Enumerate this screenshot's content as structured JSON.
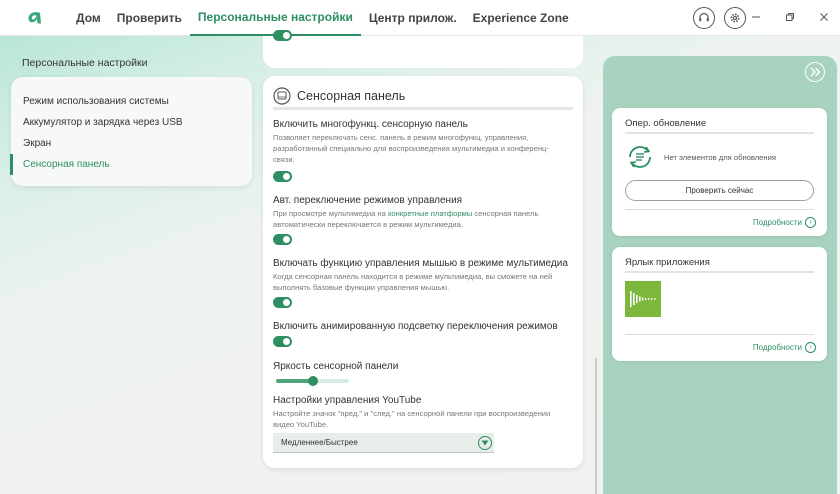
{
  "nav": {
    "items": [
      {
        "label": "Дом"
      },
      {
        "label": "Проверить"
      },
      {
        "label": "Персональные настройки"
      },
      {
        "label": "Центр прилож."
      },
      {
        "label": "Experience Zone"
      }
    ],
    "active_index": 2
  },
  "left": {
    "title": "Персональные настройки",
    "items": [
      {
        "label": "Режим использования системы"
      },
      {
        "label": "Аккумулятор и зарядка через USB"
      },
      {
        "label": "Экран"
      },
      {
        "label": "Сенсорная панель"
      }
    ],
    "active_index": 3
  },
  "touchpad": {
    "title": "Сенсорная панель",
    "multifunction": {
      "title": "Включить многофункц. сенсорную панель",
      "desc": "Позволяет переключать сенс. панель в режим многофункц. управления, разработанный специально для воспроизведения мультимедиа и конференц-связи.",
      "enabled": true
    },
    "auto_switch": {
      "title": "Авт. переключение режимов управления",
      "desc_before": "При просмотре мультимедиа на ",
      "desc_link": "конкретные платформы",
      "desc_after": " сенсорная панель автоматически переключается в режим мультимедиа.",
      "enabled": true
    },
    "mouse_control": {
      "title": "Включать функцию управления мышью в режиме мультимедиа",
      "desc": "Когда сенсорная панель находится в режиме мультимедиа, вы сможете на ней выполнять базовые функции управления мышью.",
      "enabled": true
    },
    "animated_backlight": {
      "title": "Включить анимированную подсветку переключения режимов",
      "enabled": true
    },
    "brightness": {
      "title": "Яркость сенсорной панели",
      "level": 0.5
    },
    "youtube": {
      "title": "Настройки управления YouTube",
      "desc": "Настройте значок \"пред.\" и \"след.\" на сенсорной панели при воспроизведении видео YouTube.",
      "selected": "Медленнее/Быстрее"
    }
  },
  "right": {
    "update_card": {
      "title": "Опер. обновление",
      "status": "Нет элементов для обновления",
      "button": "Проверить сейчас",
      "more": "Подробности"
    },
    "shortcut_card": {
      "title": "Ярлык приложения",
      "more": "Подробности"
    }
  },
  "colors": {
    "accent": "#2e8f63",
    "right_panel": "#a8d3bf",
    "app_tile": "#7cb83b"
  }
}
